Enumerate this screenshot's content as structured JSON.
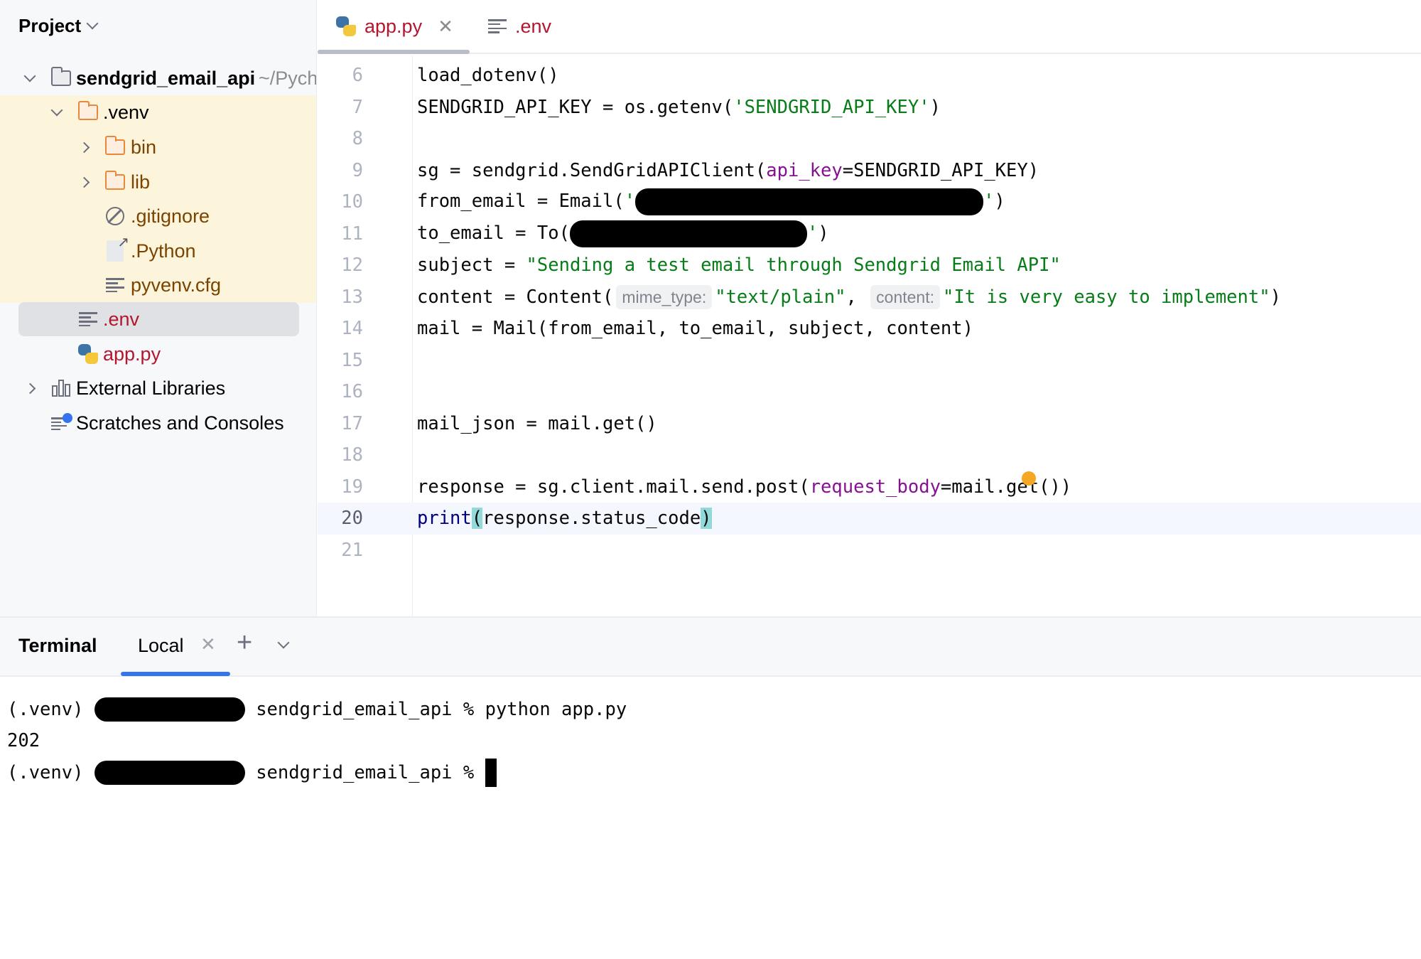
{
  "sidebar": {
    "title": "Project",
    "tree": [
      {
        "label": "sendgrid_email_api",
        "suffix": "~/Pych",
        "icon": "folder-icon",
        "expanded": true
      },
      {
        "label": ".venv",
        "icon": "folder-icon",
        "expanded": true
      },
      {
        "label": "bin",
        "icon": "folder-icon",
        "expanded": false
      },
      {
        "label": "lib",
        "icon": "folder-icon",
        "expanded": false
      },
      {
        "label": ".gitignore",
        "icon": "ignored-file-icon"
      },
      {
        "label": ".Python",
        "icon": "alias-file-icon"
      },
      {
        "label": "pyvenv.cfg",
        "icon": "text-file-icon"
      },
      {
        "label": ".env",
        "icon": "text-file-icon",
        "selected": true
      },
      {
        "label": "app.py",
        "icon": "python-file-icon"
      },
      {
        "label": "External Libraries",
        "icon": "external-libraries-icon",
        "expanded": false
      },
      {
        "label": "Scratches and Consoles",
        "icon": "scratches-icon"
      }
    ]
  },
  "tabs": [
    {
      "label": "app.py",
      "icon": "python-file-icon",
      "active": true
    },
    {
      "label": ".env",
      "icon": "text-file-icon",
      "active": false
    }
  ],
  "editor": {
    "lines": [
      {
        "n": "6",
        "text": "load_dotenv()"
      },
      {
        "n": "7",
        "a": "SENDGRID_API_KEY = os.getenv(",
        "s": "'SENDGRID_API_KEY'",
        "b": ")"
      },
      {
        "n": "8"
      },
      {
        "n": "9",
        "a": "sg = sendgrid.SendGridAPIClient(",
        "kw": "api_key",
        "b": "=SENDGRID_API_KEY)"
      },
      {
        "n": "10",
        "a": "from_email = Email(",
        "q1": "'",
        "q2": "'",
        "b": ")"
      },
      {
        "n": "11",
        "a": "to_email = To(",
        "q2": "'",
        "b": ")"
      },
      {
        "n": "12",
        "a": "subject = ",
        "s": "\"Sending a test email through Sendgrid Email API\""
      },
      {
        "n": "13",
        "a": "content = Content(",
        "hint1": "mime_type:",
        "s1": "\"text/plain\"",
        "sep": ", ",
        "hint2": "content:",
        "s2": "\"It is very easy to implement\"",
        "b": ")"
      },
      {
        "n": "14",
        "text": "mail = Mail(from_email, to_email, subject, content)"
      },
      {
        "n": "15"
      },
      {
        "n": "16"
      },
      {
        "n": "17",
        "text": "mail_json = mail.get()"
      },
      {
        "n": "18"
      },
      {
        "n": "19",
        "a": "response = sg.client.mail.send.post(",
        "kw": "request_body",
        "b": "=mail.get())"
      },
      {
        "n": "20",
        "fn": "print",
        "open": "(",
        "mid": "response.status_code",
        "close": ")"
      },
      {
        "n": "21"
      }
    ],
    "current_line": "20"
  },
  "terminal": {
    "title": "Terminal",
    "tab_label": "Local",
    "lines": [
      {
        "prefix": "(.venv)",
        "text": "sendgrid_email_api % python app.py"
      },
      {
        "text": "202"
      },
      {
        "prefix": "(.venv)",
        "text": "sendgrid_email_api %"
      }
    ]
  },
  "colors": {
    "accent": "#3574f0",
    "string": "#067d17",
    "keyword_arg": "#871094",
    "builtin": "#000080",
    "modified_file": "#b3172f",
    "excluded_file": "#7a4400",
    "venv_highlight": "#fdf4dc",
    "warning": "#f5a623"
  }
}
